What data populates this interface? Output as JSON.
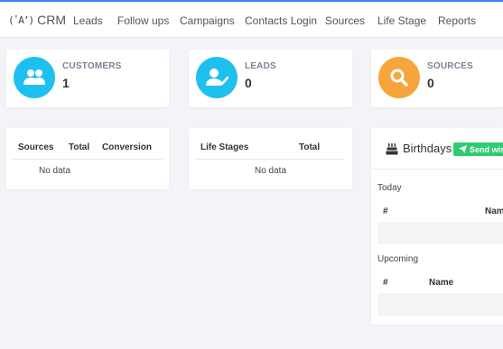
{
  "app": {
    "brand": "CRM",
    "brand_icon": "broadcast-icon"
  },
  "nav": [
    {
      "label": "Leads"
    },
    {
      "label": "Follow ups"
    },
    {
      "label": "Campaigns"
    },
    {
      "label": "Contacts Login"
    },
    {
      "label": "Sources"
    },
    {
      "label": "Life Stage"
    },
    {
      "label": "Reports"
    }
  ],
  "stats": {
    "customers": {
      "label": "CUSTOMERS",
      "value": "1",
      "color": "#1ec0f0",
      "icon": "users-icon"
    },
    "leads": {
      "label": "LEADS",
      "value": "0",
      "color": "#1ec0f0",
      "icon": "user-check-icon"
    },
    "sources": {
      "label": "SOURCES",
      "value": "0",
      "color": "#f5a53b",
      "icon": "search-icon"
    }
  },
  "sources_table": {
    "columns": [
      "Sources",
      "Total",
      "Conversion"
    ],
    "empty_text": "No data"
  },
  "lifestage_table": {
    "columns": [
      "Life Stages",
      "Total"
    ],
    "empty_text": "No data"
  },
  "birthdays": {
    "title": "Birthdays",
    "send_label": "Send wish",
    "accent": "#2ecc71",
    "today": {
      "label": "Today",
      "columns": [
        "#",
        "Nam"
      ]
    },
    "upcoming": {
      "label": "Upcoming",
      "columns": [
        "#",
        "Name"
      ]
    }
  }
}
